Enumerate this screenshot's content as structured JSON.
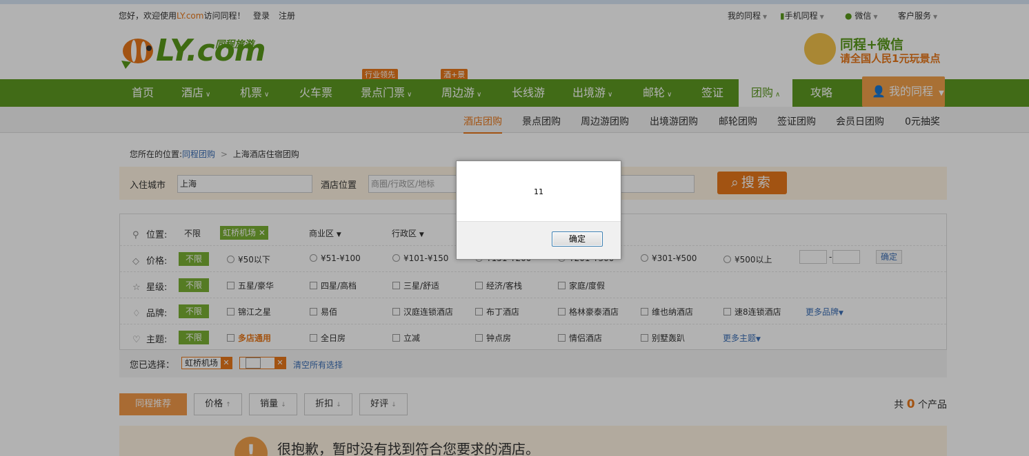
{
  "topbar": {
    "greeting_pre": "您好，欢迎使用",
    "greeting_brand": "LY.com",
    "greeting_post": "访问同程！",
    "login": "登录",
    "register": "注册",
    "my_tongcheng": "我的同程",
    "mobile": "手机同程",
    "wechat": "微信",
    "service": "客户服务"
  },
  "logo": {
    "text": "LY.com",
    "sub": "同程旅游"
  },
  "promo": {
    "line1": "同程+微信",
    "line2": "请全国人民1元玩景点"
  },
  "nav": {
    "items": [
      {
        "label": "首页"
      },
      {
        "label": "酒店"
      },
      {
        "label": "机票"
      },
      {
        "label": "火车票"
      },
      {
        "label": "景点门票"
      },
      {
        "label": "周边游"
      },
      {
        "label": "长线游"
      },
      {
        "label": "出境游"
      },
      {
        "label": "邮轮"
      },
      {
        "label": "签证"
      },
      {
        "label": "团购"
      },
      {
        "label": "攻略"
      }
    ],
    "tag_industry": "行业领先",
    "tag_hotel_plus": "酒+景",
    "my": "我的同程"
  },
  "subnav": {
    "items": [
      "酒店团购",
      "景点团购",
      "周边游团购",
      "出境游团购",
      "邮轮团购",
      "签证团购",
      "会员日团购",
      "0元抽奖"
    ]
  },
  "breadcrumb": {
    "prefix": "您所在的位置:",
    "home": "同程团购",
    "sep": ">",
    "current": "上海酒店住宿团购"
  },
  "search": {
    "city_label": "入住城市",
    "city_value": "上海",
    "location_label": "酒店位置",
    "location_placeholder": "商圈/行政区/地标",
    "button": "搜索"
  },
  "filters": {
    "location": {
      "label": "位置:",
      "unlimited": "不限",
      "selected": "虹桥机场",
      "close": "✕",
      "business": "商业区",
      "district": "行政区"
    },
    "price": {
      "label": "价格:",
      "unlimited": "不限",
      "options": [
        "¥50以下",
        "¥51-¥100",
        "¥101-¥150",
        "¥151-¥200",
        "¥201-¥300",
        "¥301-¥500",
        "¥500以上"
      ],
      "range_sep": "-",
      "confirm": "确定"
    },
    "star": {
      "label": "星级:",
      "unlimited": "不限",
      "options": [
        "五星/豪华",
        "四星/高档",
        "三星/舒适",
        "经济/客栈",
        "家庭/度假"
      ]
    },
    "brand": {
      "label": "品牌:",
      "unlimited": "不限",
      "options": [
        "锦江之星",
        "易佰",
        "汉庭连锁酒店",
        "布丁酒店",
        "格林豪泰酒店",
        "维也纳酒店",
        "速8连锁酒店"
      ],
      "more": "更多品牌"
    },
    "theme": {
      "label": "主题:",
      "unlimited": "不限",
      "options": [
        "多店通用",
        "全日房",
        "立减",
        "钟点房",
        "情侣酒店",
        "别墅轰趴"
      ],
      "more": "更多主题"
    }
  },
  "chosen": {
    "label": "您已选择：",
    "tag1": "虹桥机场",
    "x": "✕",
    "clear": "清空所有选择"
  },
  "sort": {
    "items": [
      "同程推荐",
      "价格",
      "销量",
      "折扣",
      "好评"
    ],
    "count_pre": "共",
    "count": "0",
    "count_post": "个产品"
  },
  "empty": {
    "icon": "!",
    "message": "很抱歉，暂时没有找到符合您要求的酒店。"
  },
  "dialog": {
    "message": "11",
    "ok": "确定"
  }
}
